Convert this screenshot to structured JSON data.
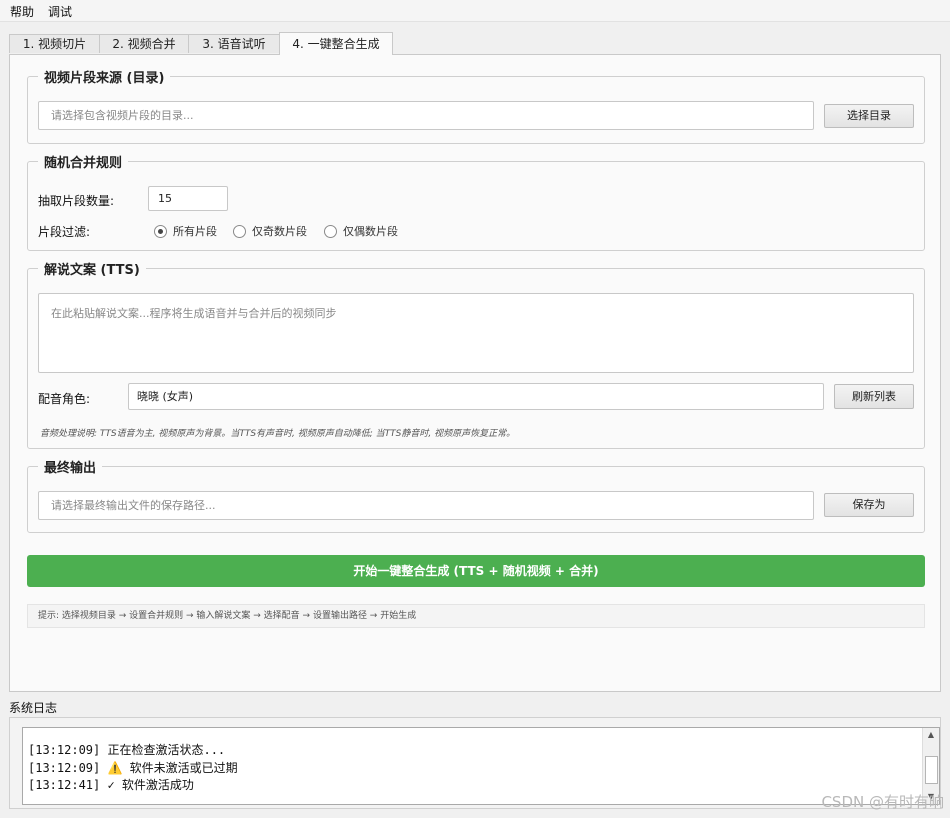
{
  "menu": {
    "items": [
      "帮助",
      "调试"
    ]
  },
  "tabs": [
    "1. 视频切片",
    "2. 视频合并",
    "3. 语音试听",
    "4. 一键整合生成"
  ],
  "source_group": {
    "title": "视频片段来源 (目录)",
    "placeholder": "请选择包含视频片段的目录...",
    "button": "选择目录"
  },
  "merge_group": {
    "title": "随机合并规则",
    "count_label": "抽取片段数量:",
    "count_value": "15",
    "filter_label": "片段过滤:",
    "options": [
      {
        "label": "所有片段",
        "checked": true
      },
      {
        "label": "仅奇数片段",
        "checked": false
      },
      {
        "label": "仅偶数片段",
        "checked": false
      }
    ]
  },
  "tts_group": {
    "title": "解说文案 (TTS)",
    "placeholder": "在此粘贴解说文案...程序将生成语音并与合并后的视频同步",
    "voice_label": "配音角色:",
    "voice_value": "晓晓 (女声)",
    "refresh_button": "刷新列表",
    "note": "音频处理说明: TTS语音为主, 视频原声为背景。当TTS有声音时, 视频原声自动降低; 当TTS静音时, 视频原声恢复正常。"
  },
  "output_group": {
    "title": "最终输出",
    "placeholder": "请选择最终输出文件的保存路径...",
    "button": "保存为"
  },
  "run_button": "开始一键整合生成 (TTS + 随机视频 + 合并)",
  "hint": "提示: 选择视频目录 → 设置合并规则 → 输入解说文案 → 选择配音 → 设置输出路径 → 开始生成",
  "log": {
    "title": "系统日志",
    "lines": [
      "[13:12:09] 正在检查激活状态...",
      "[13:12:09] ⚠️ 软件未激活或已过期",
      "[13:12:41] ✓ 软件激活成功"
    ]
  },
  "watermark": "CSDN @有时有晌"
}
